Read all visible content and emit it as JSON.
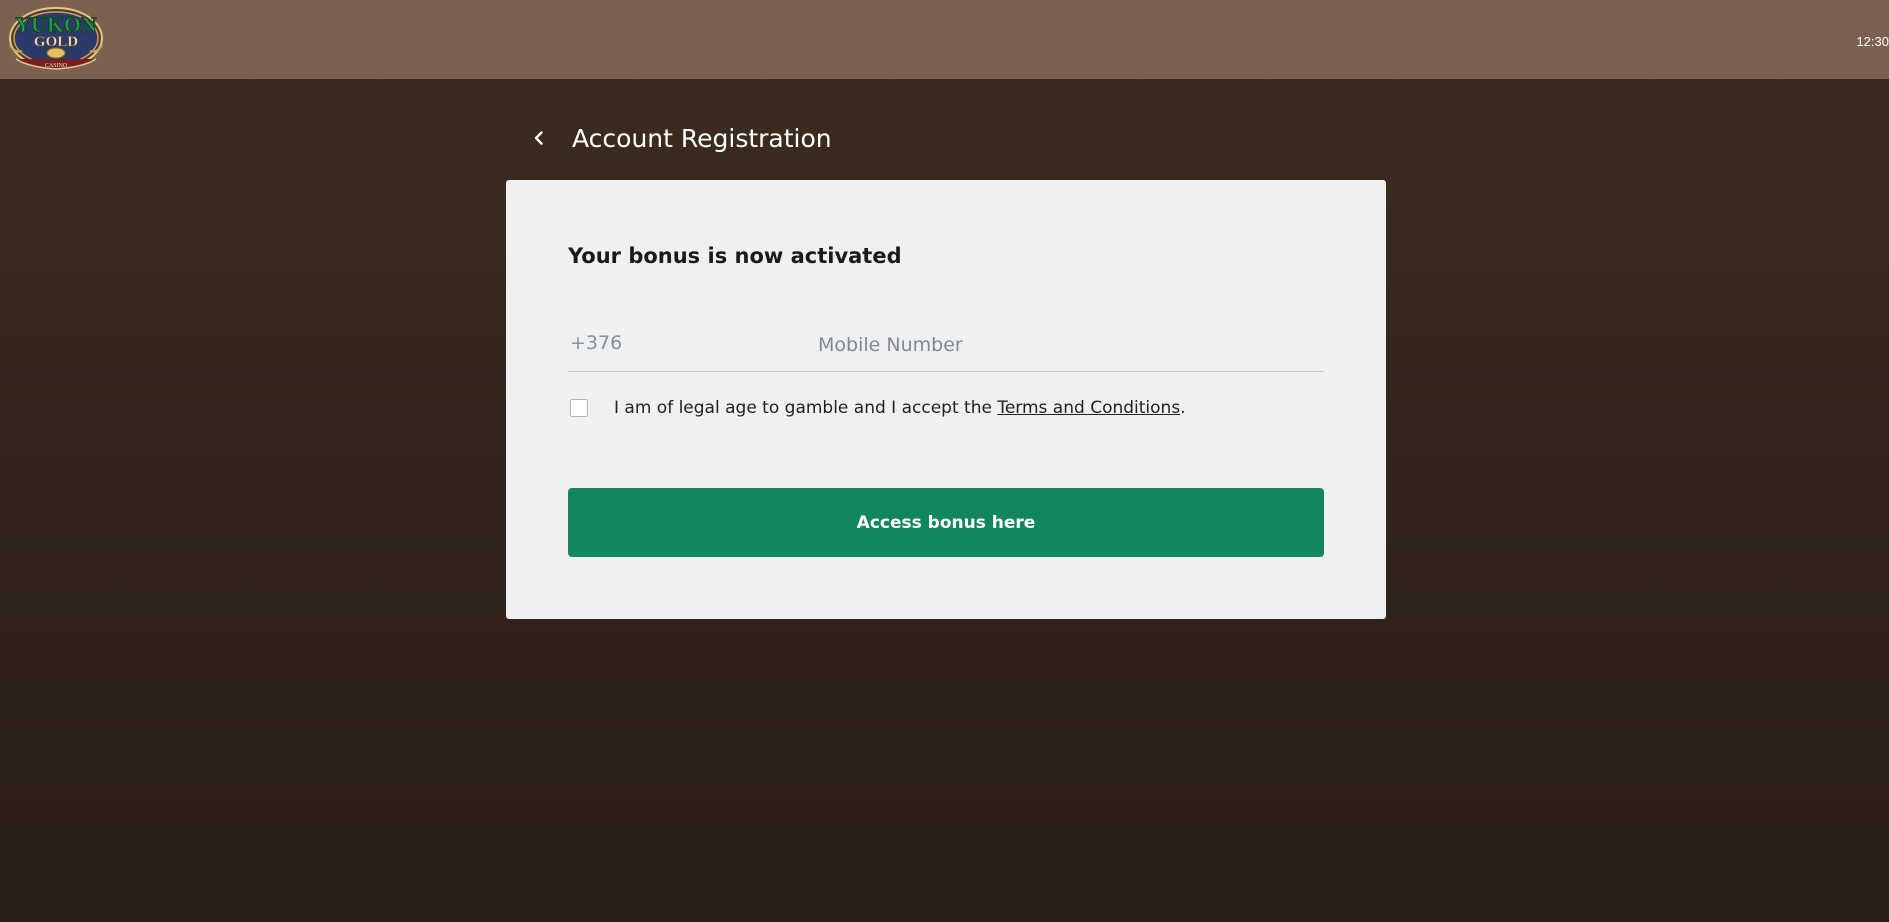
{
  "header": {
    "logo": {
      "icon": "yukon-gold-casino-logo",
      "line1": "YUKON",
      "line2": "GOLD",
      "line3": "CASINO"
    },
    "clock": "12:30"
  },
  "page": {
    "back_icon": "chevron-left-icon",
    "title": "Account Registration"
  },
  "form": {
    "heading": "Your bonus is now activated",
    "country_code": "+376",
    "mobile_placeholder": "Mobile Number",
    "mobile_value": "",
    "consent": {
      "checked": false,
      "text_before": "I am of legal age to gamble and I accept the ",
      "link_text": "Terms and Conditions",
      "text_after": "."
    },
    "submit_label": "Access bonus here"
  },
  "colors": {
    "topbar": "#7a6152",
    "background": "#33251b",
    "card": "#eef0f2",
    "button": "#12875f"
  }
}
